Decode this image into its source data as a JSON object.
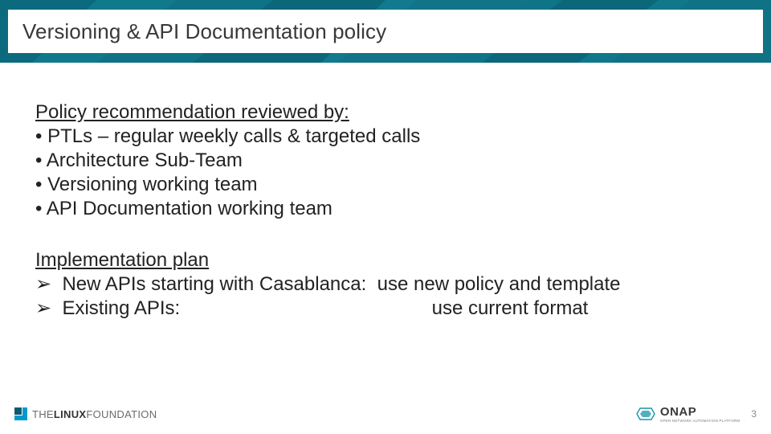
{
  "slide": {
    "title": "Versioning & API Documentation policy"
  },
  "review": {
    "heading": "Policy recommendation reviewed by:",
    "items": [
      "PTLs – regular weekly calls & targeted calls",
      "Architecture Sub-Team",
      "Versioning working team",
      "API Documentation working team"
    ]
  },
  "plan": {
    "heading": "Implementation plan",
    "items": [
      {
        "label": "New APIs starting with Casablanca:",
        "action": "use new policy and template"
      },
      {
        "label": "Existing APIs:",
        "action": "use current format"
      }
    ]
  },
  "footer": {
    "left_logo_thin": "THE",
    "left_logo_bold": "LINUX",
    "left_logo_tail": "FOUNDATION",
    "right_logo": "ONAP",
    "right_logo_sub": "OPEN NETWORK AUTOMATION PLATFORM",
    "page": "3"
  },
  "glyphs": {
    "bullet": "•",
    "arrow": "➢"
  }
}
